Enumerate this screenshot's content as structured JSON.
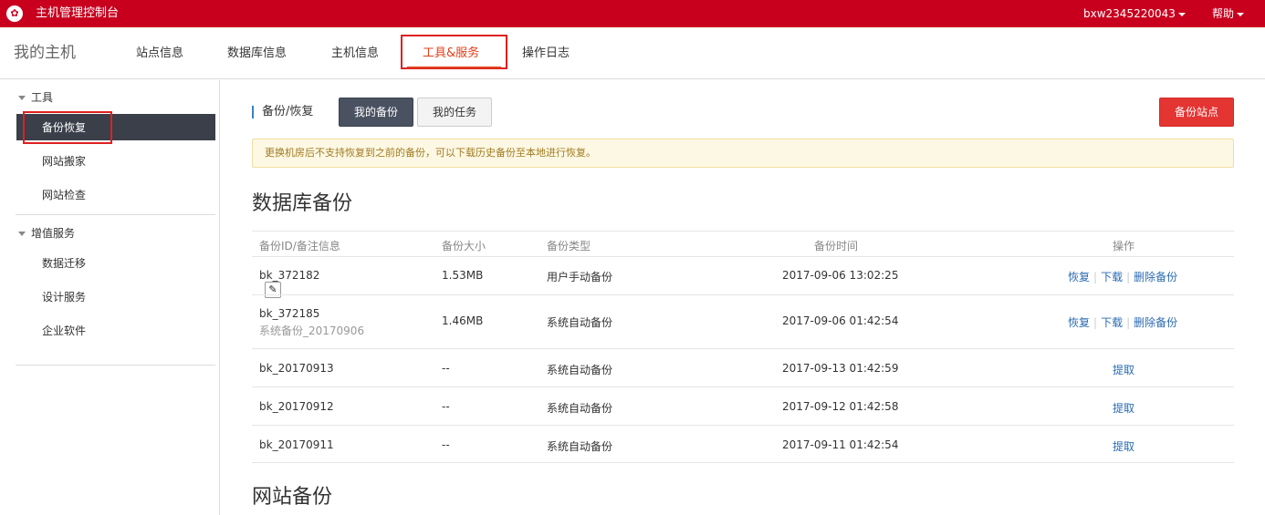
{
  "topbar": {
    "logo_glyph": "✿",
    "title": "主机管理控制台",
    "user": "bxw2345220043",
    "help": "帮助",
    "color": "#c8001e"
  },
  "nav": {
    "brand": "我的主机",
    "tabs": [
      "站点信息",
      "数据库信息",
      "主机信息",
      "工具&服务",
      "操作日志"
    ],
    "active_tab": "工具&服务"
  },
  "sidebar": {
    "groups": [
      {
        "label": "工具",
        "items": [
          "备份恢复",
          "网站搬家",
          "网站检查"
        ]
      },
      {
        "label": "增值服务",
        "items": [
          "数据迁移",
          "设计服务",
          "企业软件"
        ]
      }
    ],
    "active_item": "备份恢复"
  },
  "main": {
    "section_label": "备份/恢复",
    "tab_my_backup": "我的备份",
    "tab_my_task": "我的任务",
    "backup_site_btn": "备份站点",
    "notice": "更换机房后不支持恢复到之前的备份，可以下载历史备份至本地进行恢复。",
    "db_title": "数据库备份",
    "site_title": "网站备份",
    "columns": [
      "备份ID/备注信息",
      "备份大小",
      "备份类型",
      "备份时间",
      "操作"
    ],
    "rows": [
      {
        "id": "bk_372182",
        "note": "",
        "size": "1.53MB",
        "type": "用户手动备份",
        "time": "2017-09-06 13:02:25",
        "actions": [
          "恢复",
          "下载",
          "删除备份"
        ]
      },
      {
        "id": "bk_372185",
        "note": "系统备份_20170906",
        "size": "1.46MB",
        "type": "系统自动备份",
        "time": "2017-09-06 01:42:54",
        "actions": [
          "恢复",
          "下载",
          "删除备份"
        ]
      },
      {
        "id": "bk_20170913",
        "note": "",
        "size": "--",
        "type": "系统自动备份",
        "time": "2017-09-13 01:42:59",
        "actions": [
          "提取"
        ]
      },
      {
        "id": "bk_20170912",
        "note": "",
        "size": "--",
        "type": "系统自动备份",
        "time": "2017-09-12 01:42:58",
        "actions": [
          "提取"
        ]
      },
      {
        "id": "bk_20170911",
        "note": "",
        "size": "--",
        "type": "系统自动备份",
        "time": "2017-09-11 01:42:54",
        "actions": [
          "提取"
        ]
      }
    ]
  }
}
